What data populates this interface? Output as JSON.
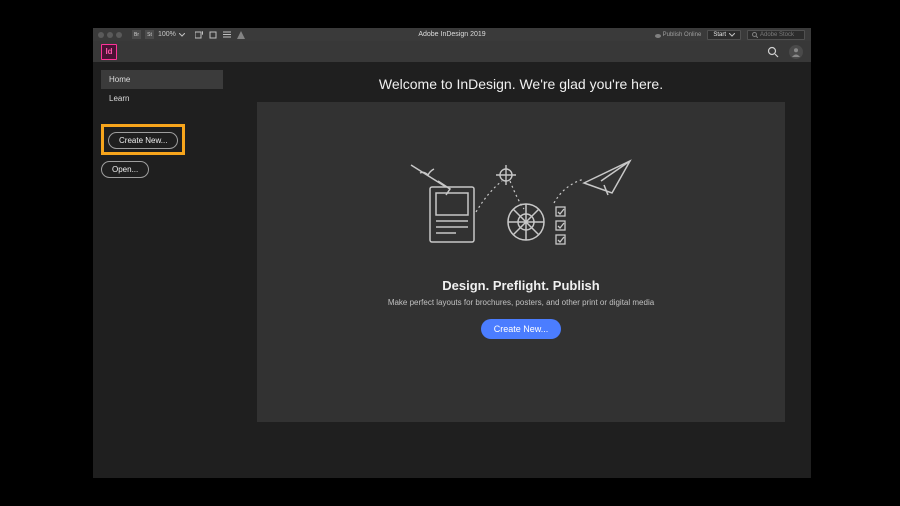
{
  "titlebar": {
    "zoom": "100%",
    "app_title": "Adobe InDesign 2019",
    "publish_online": "Publish Online",
    "start_label": "Start",
    "stock_placeholder": "Adobe Stock"
  },
  "appbar": {
    "logo_text": "Id"
  },
  "sidebar": {
    "items": [
      {
        "label": "Home",
        "active": true
      },
      {
        "label": "Learn",
        "active": false
      }
    ],
    "create_new_label": "Create New...",
    "open_label": "Open..."
  },
  "main": {
    "welcome": "Welcome to InDesign. We're glad you're here.",
    "hero_title": "Design. Preflight. Publish",
    "hero_subtitle": "Make perfect layouts for brochures, posters, and other print or digital media",
    "cta_label": "Create New..."
  }
}
